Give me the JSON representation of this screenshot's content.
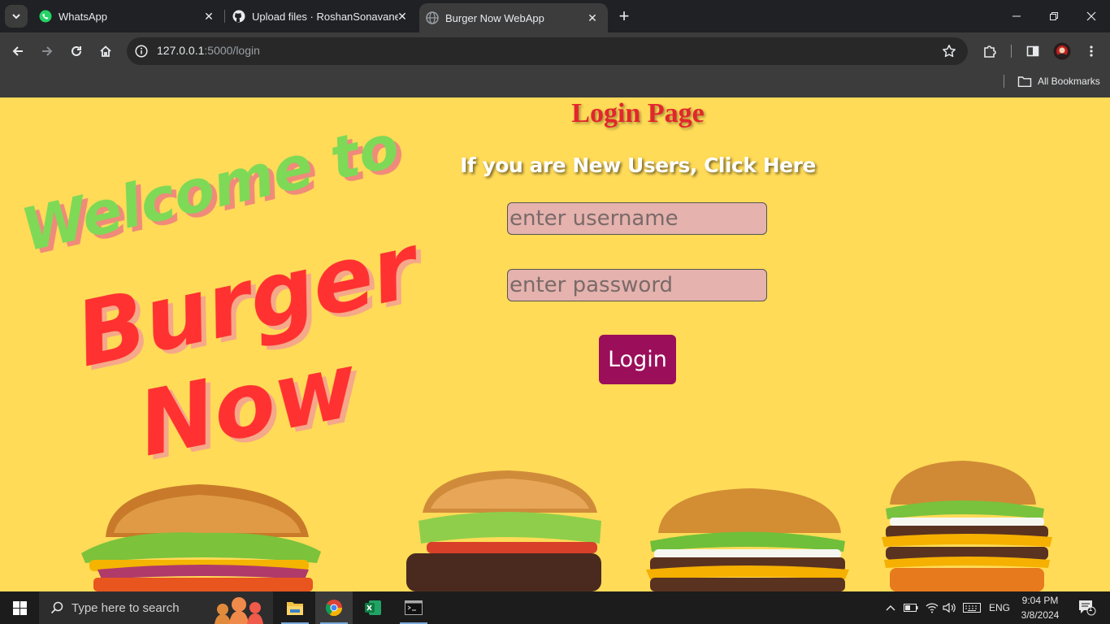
{
  "browser": {
    "tabs": [
      {
        "title": "WhatsApp",
        "icon": "whatsapp-icon"
      },
      {
        "title": "Upload files · RoshanSonavane/",
        "icon": "github-icon"
      },
      {
        "title": "Burger Now WebApp",
        "icon": "globe-icon",
        "active": true
      }
    ],
    "address": {
      "host": "127.0.0.1",
      "path": ":5000/login"
    },
    "bookmarks_label": "All Bookmarks"
  },
  "page": {
    "welcome_line1": "Welcome to",
    "welcome_line2": "Burger",
    "welcome_line3": "Now",
    "heading": "Login Page",
    "signup_link": "If you are New Users, Click Here",
    "username_placeholder": "enter username",
    "password_placeholder": "enter password",
    "login_button": "Login",
    "colors": {
      "background": "#ffdb57",
      "heading": "#e3262d",
      "welcome": "#7ed957",
      "burger_text": "#ff3131",
      "button": "#9a0e5a",
      "field": "#e5b2ad"
    }
  },
  "taskbar": {
    "search_placeholder": "Type here to search",
    "apps": [
      "file-explorer-icon",
      "chrome-icon",
      "excel-icon",
      "terminal-icon"
    ],
    "language": "ENG",
    "time": "9:04 PM",
    "date": "3/8/2024",
    "notification_count": "1"
  }
}
